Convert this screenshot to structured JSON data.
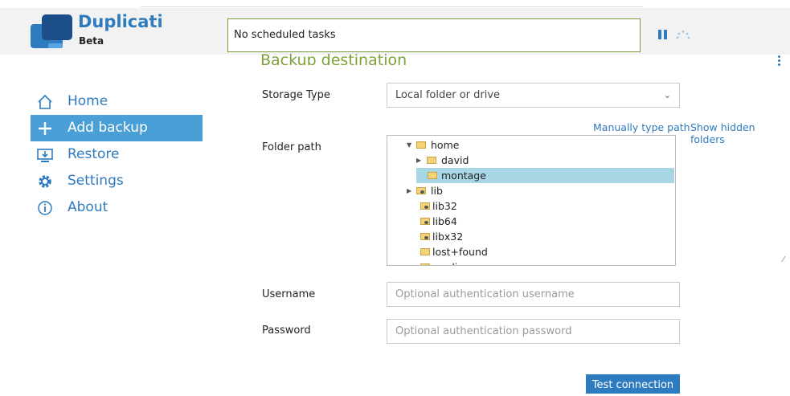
{
  "app": {
    "title": "Duplicati",
    "subtitle": "Beta"
  },
  "status": {
    "text": "No scheduled tasks"
  },
  "section": {
    "title": "Backup destination"
  },
  "nav": {
    "items": [
      {
        "label": "Home",
        "icon": "home-icon",
        "active": false
      },
      {
        "label": "Add backup",
        "icon": "plus-icon",
        "active": true
      },
      {
        "label": "Restore",
        "icon": "restore-icon",
        "active": false
      },
      {
        "label": "Settings",
        "icon": "gear-icon",
        "active": false
      },
      {
        "label": "About",
        "icon": "info-icon",
        "active": false
      }
    ]
  },
  "form": {
    "storage_type_label": "Storage Type",
    "storage_type_value": "Local folder or drive",
    "folder_path_label": "Folder path",
    "manually_type_link": "Manually type path",
    "show_hidden_link": "Show hidden folders",
    "username_label": "Username",
    "username_placeholder": "Optional authentication username",
    "password_label": "Password",
    "password_placeholder": "Optional authentication password",
    "test_button": "Test connection"
  },
  "tree": {
    "nodes": [
      {
        "label": "home",
        "expanded": true
      },
      {
        "label": "david",
        "expanded": false
      },
      {
        "label": "montage",
        "selected": true
      },
      {
        "label": "lib",
        "expanded": false
      },
      {
        "label": "lib32"
      },
      {
        "label": "lib64"
      },
      {
        "label": "libx32"
      },
      {
        "label": "lost+found"
      },
      {
        "label": "media"
      }
    ]
  },
  "colors": {
    "accent": "#2f7bbf",
    "section_title": "#7ea23a",
    "nav_active": "#4a9fd6",
    "tree_selected": "#a9d6e5"
  }
}
